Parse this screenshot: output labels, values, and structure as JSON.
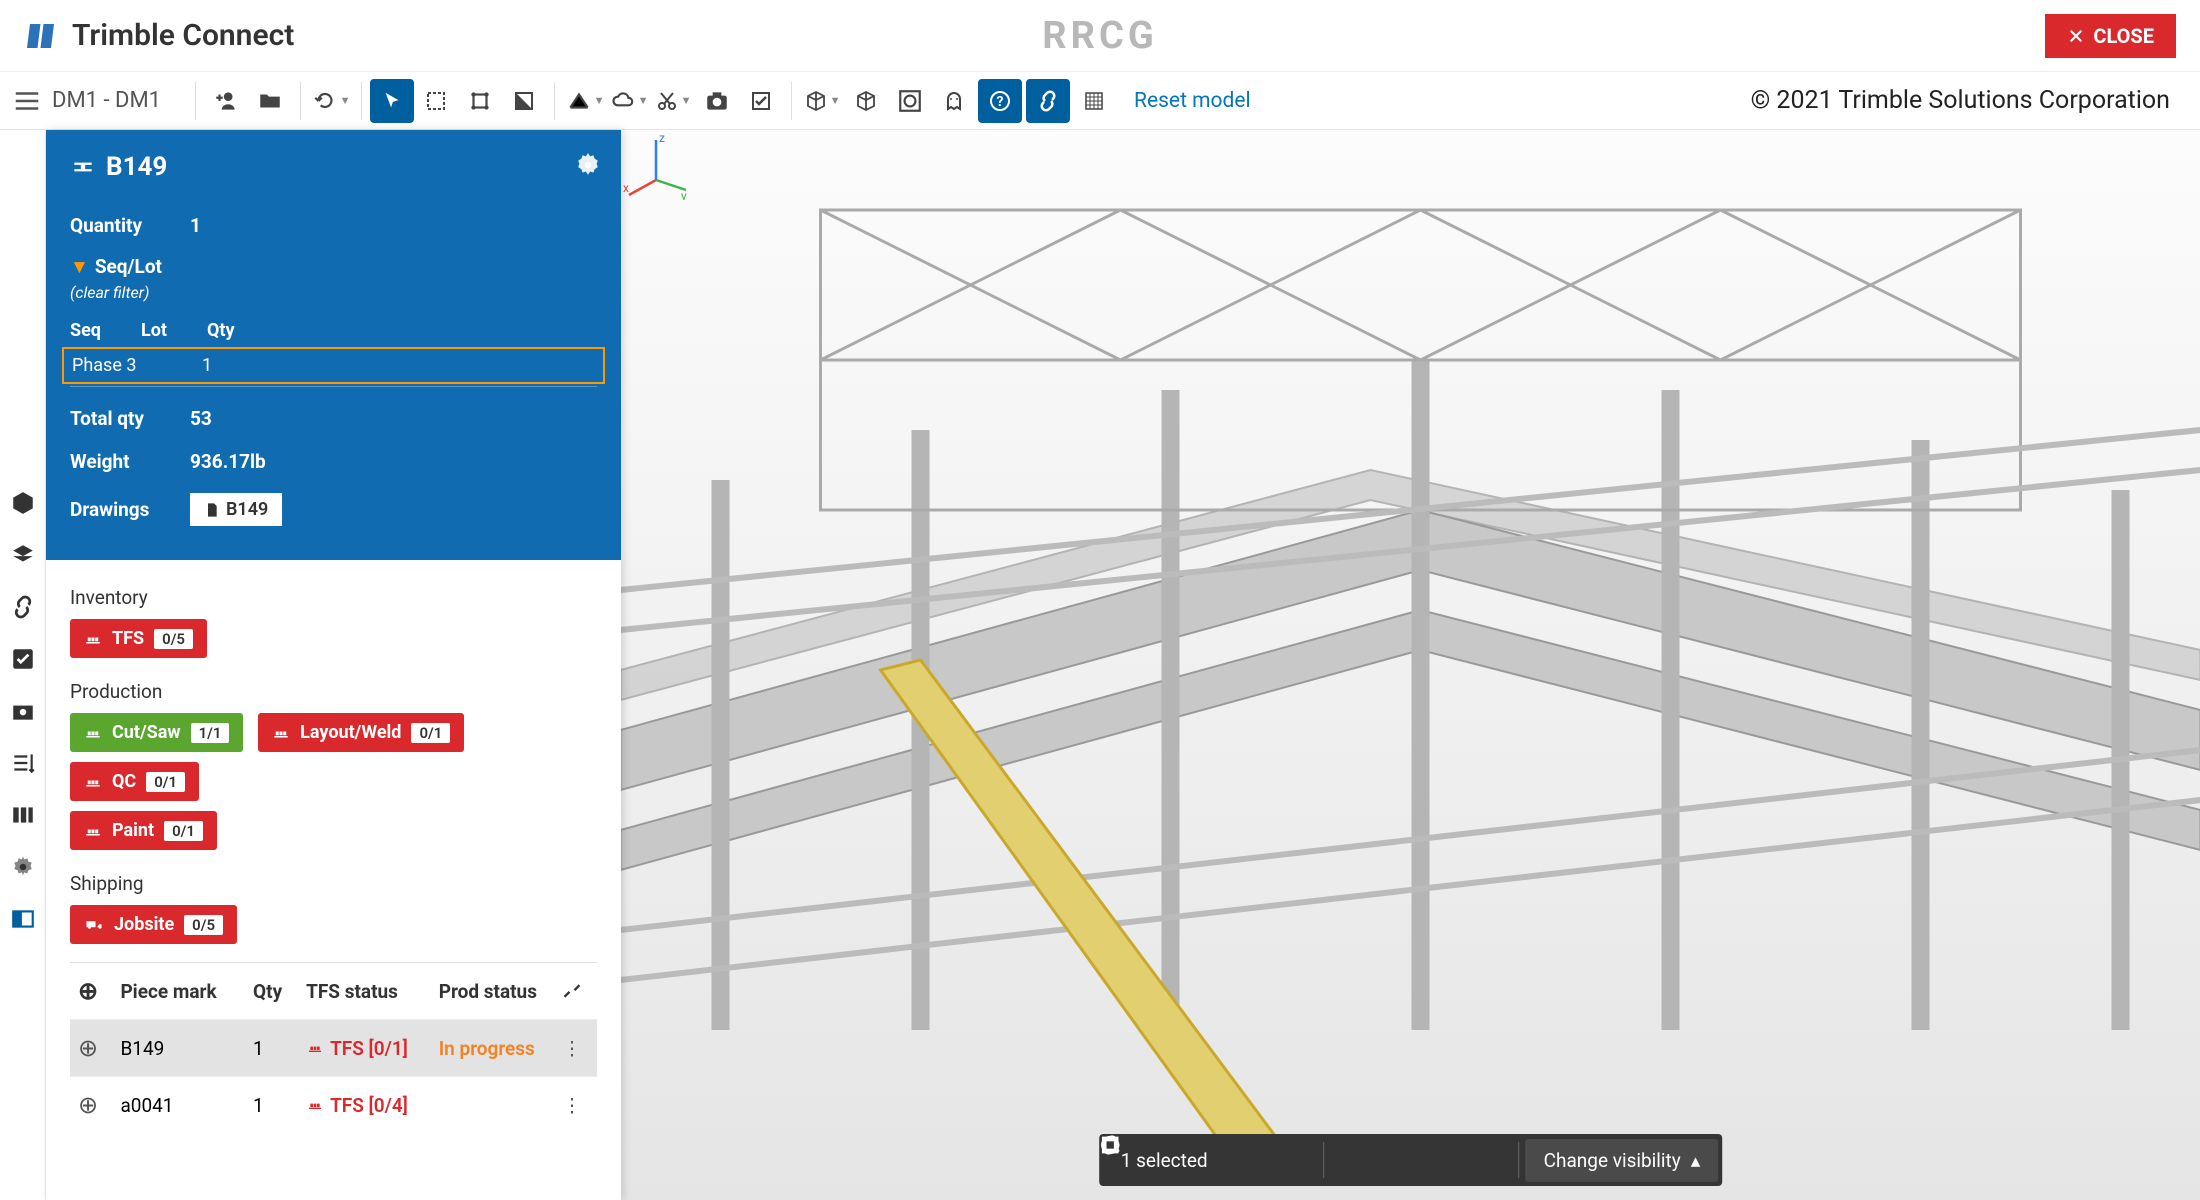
{
  "header": {
    "app_name": "Trimble Connect",
    "watermark": "RRCG",
    "close": "CLOSE"
  },
  "toolbar": {
    "title": "DM1 - DM1",
    "reset": "Reset model"
  },
  "copyright": "© 2021 Trimble Solutions Corporation",
  "panel": {
    "id": "B149",
    "quantity_label": "Quantity",
    "quantity": "1",
    "seqlot_label": "Seq/Lot",
    "clear_filter": "(clear filter)",
    "seq_head": {
      "c1": "Seq",
      "c2": "Lot",
      "c3": "Qty"
    },
    "seq_row": {
      "c1": "Phase 3",
      "c2": "",
      "c3": "1"
    },
    "totalqty_label": "Total qty",
    "totalqty": "53",
    "weight_label": "Weight",
    "weight": "936.17lb",
    "drawings_label": "Drawings",
    "drawing_chip": "B149",
    "inventory": {
      "label": "Inventory",
      "tfs": "TFS",
      "tfs_count": "0/5"
    },
    "production": {
      "label": "Production",
      "cutsaw": "Cut/Saw",
      "cutsaw_count": "1/1",
      "layout": "Layout/Weld",
      "layout_count": "0/1",
      "qc": "QC",
      "qc_count": "0/1",
      "paint": "Paint",
      "paint_count": "0/1"
    },
    "shipping": {
      "label": "Shipping",
      "jobsite": "Jobsite",
      "jobsite_count": "0/5"
    },
    "table": {
      "head": {
        "c2": "Piece mark",
        "c3": "Qty",
        "c4": "TFS status",
        "c5": "Prod status"
      },
      "rows": [
        {
          "mark": "B149",
          "qty": "1",
          "tfs": "TFS [0/1]",
          "prod": "In progress"
        },
        {
          "mark": "a0041",
          "qty": "1",
          "tfs": "TFS [0/4]",
          "prod": ""
        }
      ]
    }
  },
  "bottombar": {
    "selected": "1 selected",
    "change": "Change visibility"
  }
}
